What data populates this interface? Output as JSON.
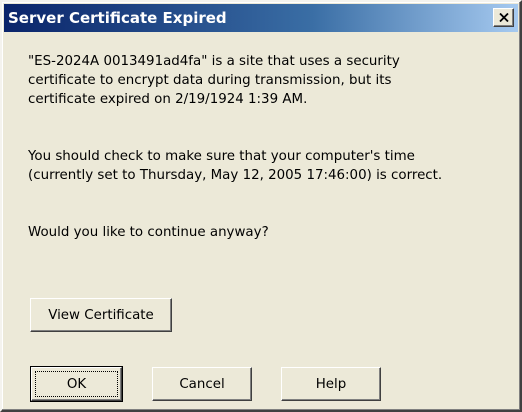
{
  "dialog": {
    "title": "Server Certificate Expired",
    "close_label": "Close"
  },
  "message": {
    "para1_line1": "\"ES-2024A 0013491ad4fa\" is a site that uses a security",
    "para1_line2": "certificate to encrypt data during transmission, but its",
    "para1_line3": "certificate expired on 2/19/1924 1:39 AM.",
    "para2_line1": "You should check to make sure that your computer's time",
    "para2_line2": "(currently set to Thursday, May 12, 2005 17:46:00) is correct.",
    "question": "Would you like to continue anyway?"
  },
  "buttons": {
    "view_certificate": "View Certificate",
    "ok": "OK",
    "cancel": "Cancel",
    "help": "Help"
  },
  "colors": {
    "dialog_background": "#ece9d8",
    "titlebar_start": "#0a246a",
    "titlebar_end": "#a6caf0",
    "title_text": "#ffffff"
  },
  "icons": {
    "close": "close-icon"
  }
}
